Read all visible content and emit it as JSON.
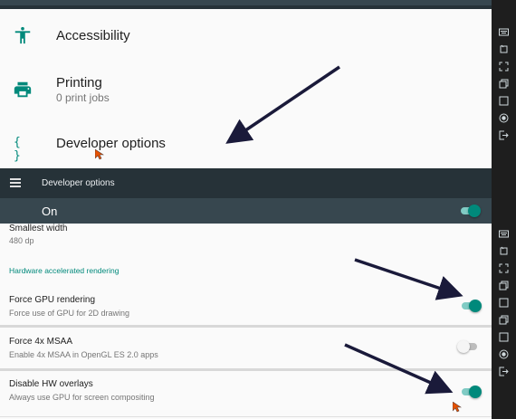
{
  "settings_list": {
    "items": [
      {
        "title": "Accessibility",
        "subtitle": "",
        "icon": "accessibility-icon"
      },
      {
        "title": "Printing",
        "subtitle": "0 print jobs",
        "icon": "printer-icon"
      },
      {
        "title": "Developer options",
        "subtitle": "",
        "icon": "code-braces-icon",
        "icon_glyph": "{ }"
      }
    ]
  },
  "developer_options": {
    "toolbar_title": "Developer options",
    "master_switch": {
      "label": "On",
      "state": "on"
    },
    "items": [
      {
        "title": "Smallest width",
        "subtitle": "480 dp"
      },
      {
        "section": "Hardware accelerated rendering"
      },
      {
        "title": "Force GPU rendering",
        "subtitle": "Force use of GPU for 2D drawing",
        "toggle": "on"
      },
      {
        "title": "Force 4x MSAA",
        "subtitle": "Enable 4x MSAA in OpenGL ES 2.0 apps",
        "toggle": "off"
      },
      {
        "title": "Disable HW overlays",
        "subtitle": "Always use GPU for screen compositing",
        "toggle": "on"
      }
    ]
  },
  "colors": {
    "accent": "#00897b",
    "toolbar": "#263238",
    "switch_bar": "#37474f",
    "annotation_arrow": "#1a1a3a"
  },
  "emulator_sidebar": {
    "icons": [
      "keyboard-icon",
      "rotate-icon",
      "fullscreen-icon",
      "multi-window-icon",
      "square-icon",
      "record-icon",
      "exit-icon"
    ]
  }
}
